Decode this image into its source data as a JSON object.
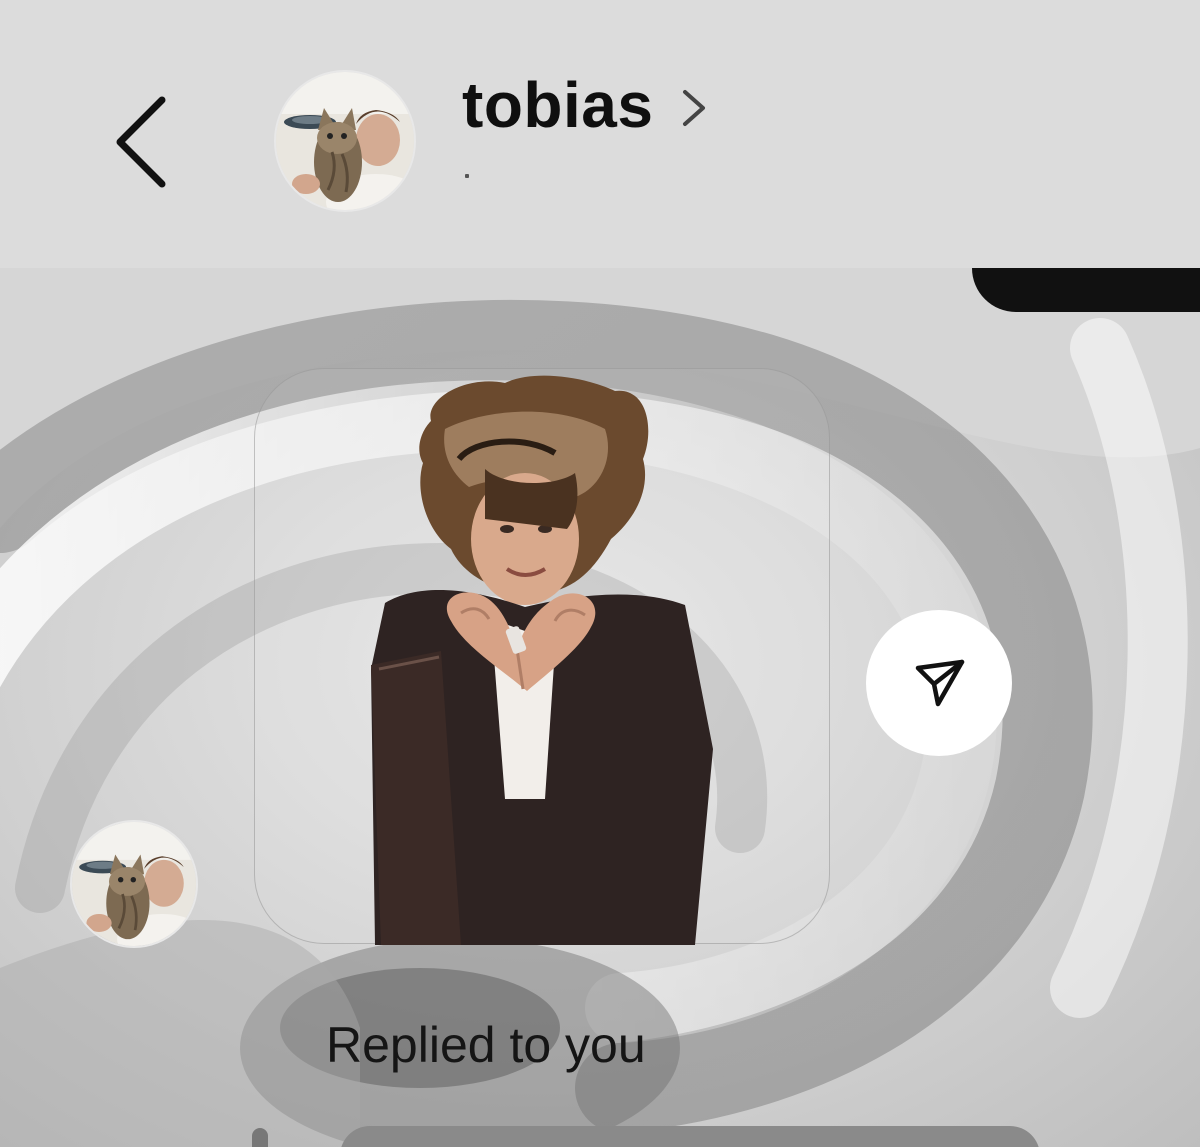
{
  "header": {
    "contact_name": "tobias",
    "back_icon": "chevron-left-icon",
    "profile_chevron_icon": "chevron-right-icon",
    "avatar_description": "profile-photo-with-cat"
  },
  "conversation": {
    "message": {
      "type": "sticker",
      "sticker_description": "man-making-heart-hands",
      "share_icon": "send-arrow-icon"
    },
    "reply_label": "Replied to you"
  },
  "colors": {
    "header_bg": "#dcdcdc",
    "chat_bg": "#d2d2d2",
    "outgoing_bubble": "#111111",
    "share_button_bg": "#ffffff"
  }
}
